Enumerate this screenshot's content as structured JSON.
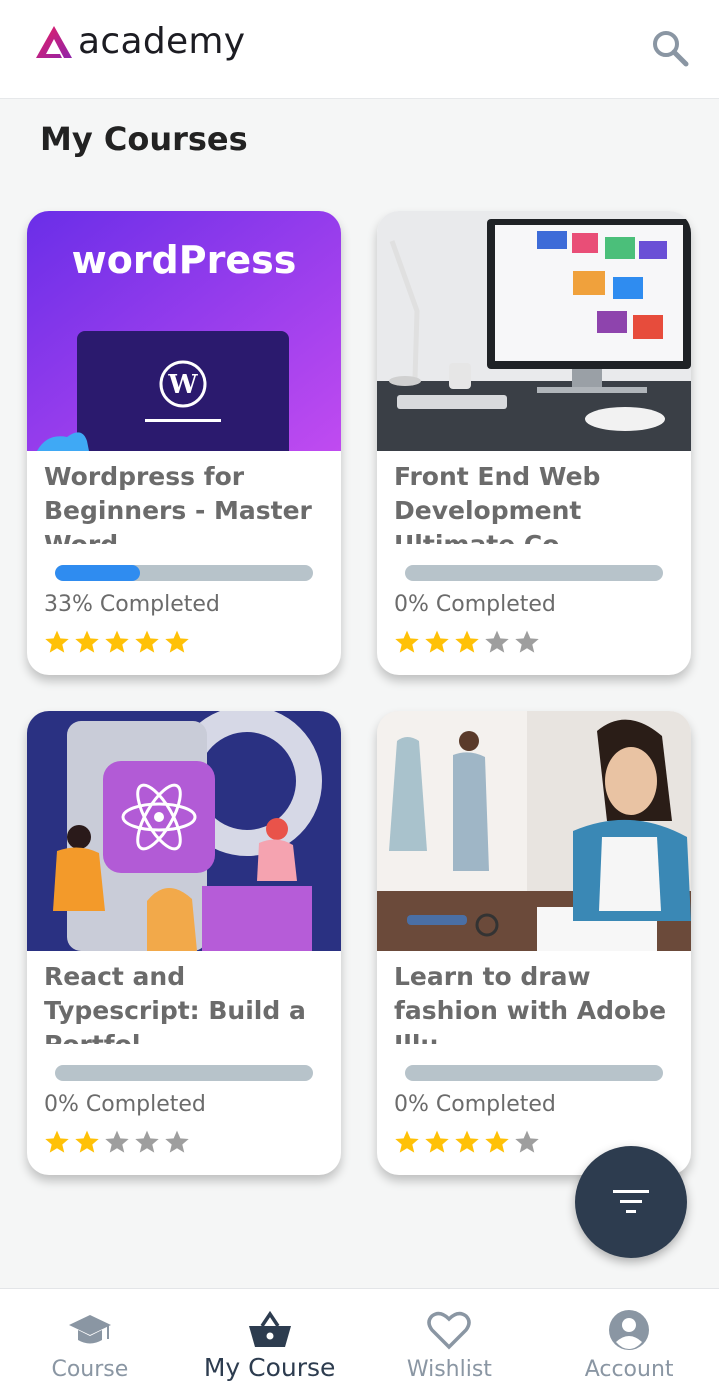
{
  "app": {
    "logo_text": "academy"
  },
  "page": {
    "title": "My Courses"
  },
  "courses": [
    {
      "title": "Wordpress for Beginners - Master Word",
      "thumb_text": "wordPress",
      "progress": 0.33,
      "completed_label": "33% Completed",
      "rating": 5
    },
    {
      "title": "Front End Web Development Ultimate Co",
      "progress": 0.0,
      "completed_label": "0% Completed",
      "rating": 3
    },
    {
      "title": "React and Typescript: Build a Portfol",
      "progress": 0.0,
      "completed_label": "0% Completed",
      "rating": 2
    },
    {
      "title": "Learn to draw fashion with Adobe Illu",
      "progress": 0.0,
      "completed_label": "0% Completed",
      "rating": 4
    }
  ],
  "nav": {
    "items": [
      {
        "label": "Course",
        "icon": "graduation-cap-icon",
        "active": false
      },
      {
        "label": "My Course",
        "icon": "basket-icon",
        "active": true
      },
      {
        "label": "Wishlist",
        "icon": "heart-icon",
        "active": false
      },
      {
        "label": "Account",
        "icon": "account-circle-icon",
        "active": false
      }
    ]
  },
  "colors": {
    "accent": "#2f8cf0",
    "star": "#ffc107",
    "star_empty": "#9e9e9e",
    "fab": "#2d3c4f",
    "brand": "#c2185b"
  }
}
